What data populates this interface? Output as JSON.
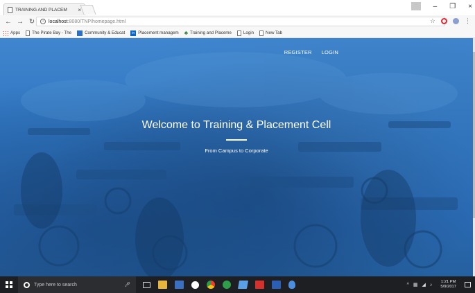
{
  "browser": {
    "tab_title": "TRAINING AND PLACEM",
    "tab_close": "×",
    "window_controls": {
      "minimize": "–",
      "close": "×"
    },
    "url_host": "localhost",
    "url_path": ":8080/TNP/homepage.html",
    "bookmarks": [
      {
        "label": "Apps",
        "icon": "apps-grid-icon"
      },
      {
        "label": "The Pirate Bay - The",
        "icon": "page-icon"
      },
      {
        "label": "Community & Educat",
        "icon": "community-icon"
      },
      {
        "label": "Placement managem",
        "icon": "linkedin-icon"
      },
      {
        "label": "Training and Placeme",
        "icon": "clover-icon"
      },
      {
        "label": "Login",
        "icon": "page-icon"
      },
      {
        "label": "New Tab",
        "icon": "page-icon"
      }
    ]
  },
  "page": {
    "nav": {
      "register": "REGISTER",
      "login": "LOGIN"
    },
    "hero_title": "Welcome to Training & Placement Cell",
    "hero_subtitle": "From Campus to Corporate"
  },
  "taskbar": {
    "search_placeholder": "Type here to search",
    "time": "1:21 PM",
    "date": "5/9/2017"
  },
  "colors": {
    "hero_overlay": "#2f74bf",
    "taskbar": "#1d1f23"
  }
}
